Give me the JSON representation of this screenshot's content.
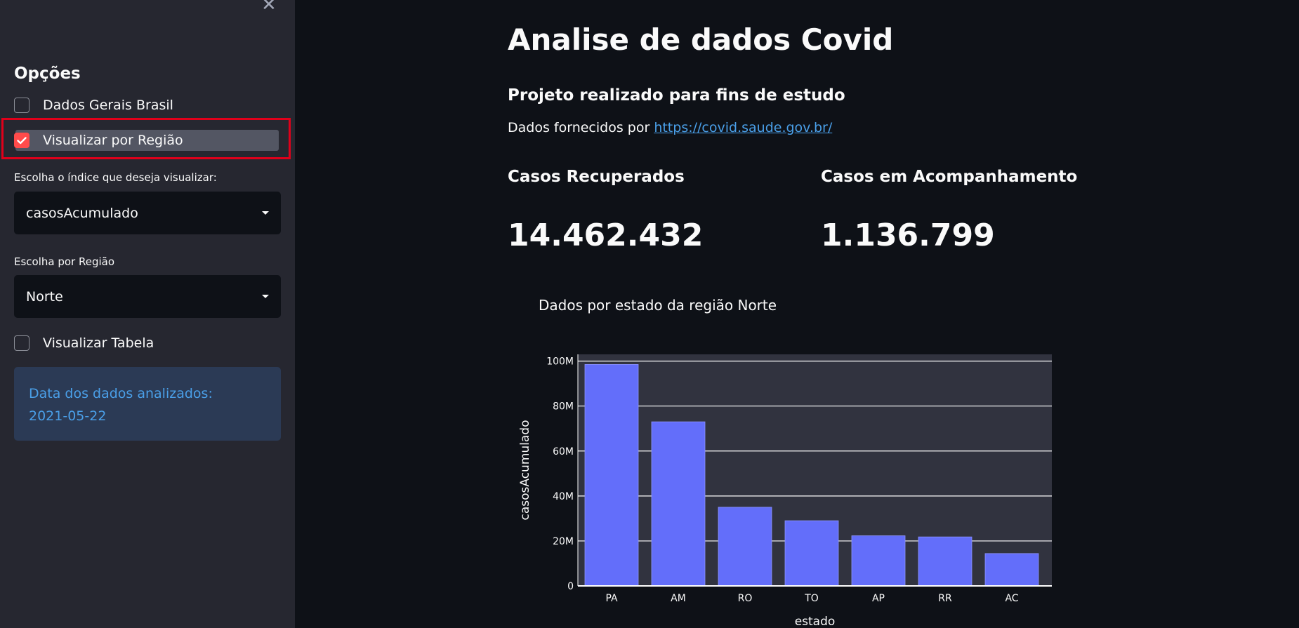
{
  "sidebar": {
    "close_glyph": "✕",
    "title": "Opções",
    "checkboxes": {
      "dados_gerais": {
        "label": "Dados Gerais Brasil",
        "checked": false
      },
      "por_regiao": {
        "label": "Visualizar por Região",
        "checked": true
      },
      "tabela": {
        "label": "Visualizar Tabela",
        "checked": false
      }
    },
    "indice": {
      "label": "Escolha o índice que deseja visualizar:",
      "value": "casosAcumulado"
    },
    "regiao": {
      "label": "Escolha por Região",
      "value": "Norte"
    },
    "info": {
      "line1": "Data dos dados analizados:",
      "line2": "2021-05-22"
    }
  },
  "main": {
    "title": "Analise de dados Covid",
    "subtitle": "Projeto realizado para fins de estudo",
    "source_prefix": "Dados fornecidos por",
    "source_link": "https://covid.saude.gov.br/",
    "metrics": [
      {
        "label": "Casos Recuperados",
        "value": "14.462.432"
      },
      {
        "label": "Casos em Acompanhamento",
        "value": "1.136.799"
      }
    ],
    "chart_title": "Dados por estado da região Norte"
  },
  "colors": {
    "accent": "#ff4b4b",
    "bar": "#636efa",
    "plot_bg": "#31333f",
    "info_text": "#4a9fe8"
  },
  "chart_data": {
    "type": "bar",
    "categories": [
      "PA",
      "AM",
      "RO",
      "TO",
      "AP",
      "RR",
      "AC"
    ],
    "values": [
      98500000,
      73000000,
      35000000,
      29000000,
      22300000,
      21800000,
      14400000
    ],
    "xlabel": "estado",
    "ylabel": "casosAcumulado",
    "ylim": [
      0,
      103000000
    ],
    "yticks": [
      0,
      20000000,
      40000000,
      60000000,
      80000000,
      100000000
    ],
    "ytick_labels": [
      "0",
      "20M",
      "40M",
      "60M",
      "80M",
      "100M"
    ],
    "grid": true
  }
}
